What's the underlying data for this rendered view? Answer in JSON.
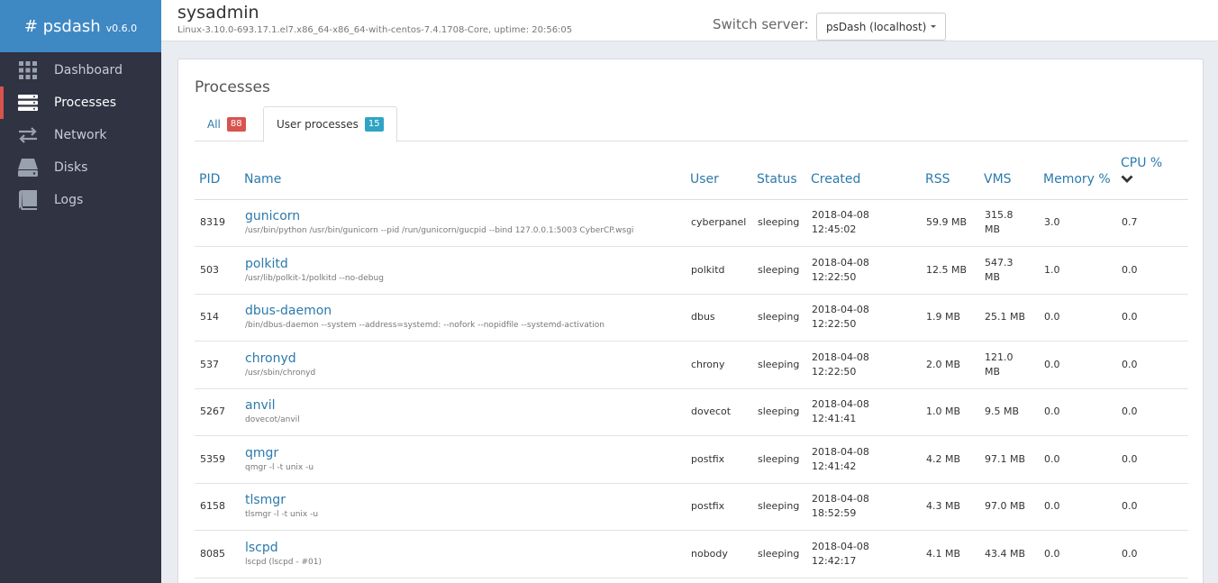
{
  "brand": {
    "name": "# psdash",
    "version": "v0.6.0"
  },
  "sidebar": {
    "items": [
      {
        "label": "Dashboard",
        "icon": "dashboard-grid-icon",
        "active": false
      },
      {
        "label": "Processes",
        "icon": "server-list-icon",
        "active": true
      },
      {
        "label": "Network",
        "icon": "exchange-arrows-icon",
        "active": false
      },
      {
        "label": "Disks",
        "icon": "hard-drive-icon",
        "active": false
      },
      {
        "label": "Logs",
        "icon": "book-icon",
        "active": false
      }
    ]
  },
  "header": {
    "hostname": "sysadmin",
    "sysinfo": "Linux-3.10.0-693.17.1.el7.x86_64-x86_64-with-centos-7.4.1708-Core, uptime: 20:56:05",
    "switch_label": "Switch server:",
    "server_selected": "psDash (localhost)"
  },
  "panel": {
    "title": "Processes",
    "tabs": [
      {
        "label": "All",
        "count": "88",
        "active": false
      },
      {
        "label": "User processes",
        "count": "15",
        "active": true
      }
    ]
  },
  "table": {
    "columns": [
      "PID",
      "Name",
      "User",
      "Status",
      "Created",
      "RSS",
      "VMS",
      "Memory %",
      "CPU %"
    ],
    "sorted_column": "CPU %",
    "rows": [
      {
        "pid": "8319",
        "name": "gunicorn",
        "cmd": "/usr/bin/python /usr/bin/gunicorn --pid /run/gunicorn/gucpid --bind 127.0.0.1:5003 CyberCP.wsgi",
        "user": "cyberpanel",
        "status": "sleeping",
        "created_date": "2018-04-08",
        "created_time": "12:45:02",
        "rss": "59.9 MB",
        "vms_a": "315.8",
        "vms_b": "MB",
        "mem": "3.0",
        "cpu": "0.7"
      },
      {
        "pid": "503",
        "name": "polkitd",
        "cmd": "/usr/lib/polkit-1/polkitd --no-debug",
        "user": "polkitd",
        "status": "sleeping",
        "created_date": "2018-04-08",
        "created_time": "12:22:50",
        "rss": "12.5 MB",
        "vms_a": "547.3",
        "vms_b": "MB",
        "mem": "1.0",
        "cpu": "0.0"
      },
      {
        "pid": "514",
        "name": "dbus-daemon",
        "cmd": "/bin/dbus-daemon --system --address=systemd: --nofork --nopidfile --systemd-activation",
        "user": "dbus",
        "status": "sleeping",
        "created_date": "2018-04-08",
        "created_time": "12:22:50",
        "rss": "1.9 MB",
        "vms_a": "25.1 MB",
        "vms_b": "",
        "mem": "0.0",
        "cpu": "0.0"
      },
      {
        "pid": "537",
        "name": "chronyd",
        "cmd": "/usr/sbin/chronyd",
        "user": "chrony",
        "status": "sleeping",
        "created_date": "2018-04-08",
        "created_time": "12:22:50",
        "rss": "2.0 MB",
        "vms_a": "121.0",
        "vms_b": "MB",
        "mem": "0.0",
        "cpu": "0.0"
      },
      {
        "pid": "5267",
        "name": "anvil",
        "cmd": "dovecot/anvil",
        "user": "dovecot",
        "status": "sleeping",
        "created_date": "2018-04-08",
        "created_time": "12:41:41",
        "rss": "1.0 MB",
        "vms_a": "9.5 MB",
        "vms_b": "",
        "mem": "0.0",
        "cpu": "0.0"
      },
      {
        "pid": "5359",
        "name": "qmgr",
        "cmd": "qmgr -l -t unix -u",
        "user": "postfix",
        "status": "sleeping",
        "created_date": "2018-04-08",
        "created_time": "12:41:42",
        "rss": "4.2 MB",
        "vms_a": "97.1 MB",
        "vms_b": "",
        "mem": "0.0",
        "cpu": "0.0"
      },
      {
        "pid": "6158",
        "name": "tlsmgr",
        "cmd": "tlsmgr -l -t unix -u",
        "user": "postfix",
        "status": "sleeping",
        "created_date": "2018-04-08",
        "created_time": "18:52:59",
        "rss": "4.3 MB",
        "vms_a": "97.0 MB",
        "vms_b": "",
        "mem": "0.0",
        "cpu": "0.0"
      },
      {
        "pid": "8085",
        "name": "lscpd",
        "cmd": "lscpd (lscpd - #01)",
        "user": "nobody",
        "status": "sleeping",
        "created_date": "2018-04-08",
        "created_time": "12:42:17",
        "rss": "4.1 MB",
        "vms_a": "43.4 MB",
        "vms_b": "",
        "mem": "0.0",
        "cpu": "0.0"
      }
    ]
  }
}
